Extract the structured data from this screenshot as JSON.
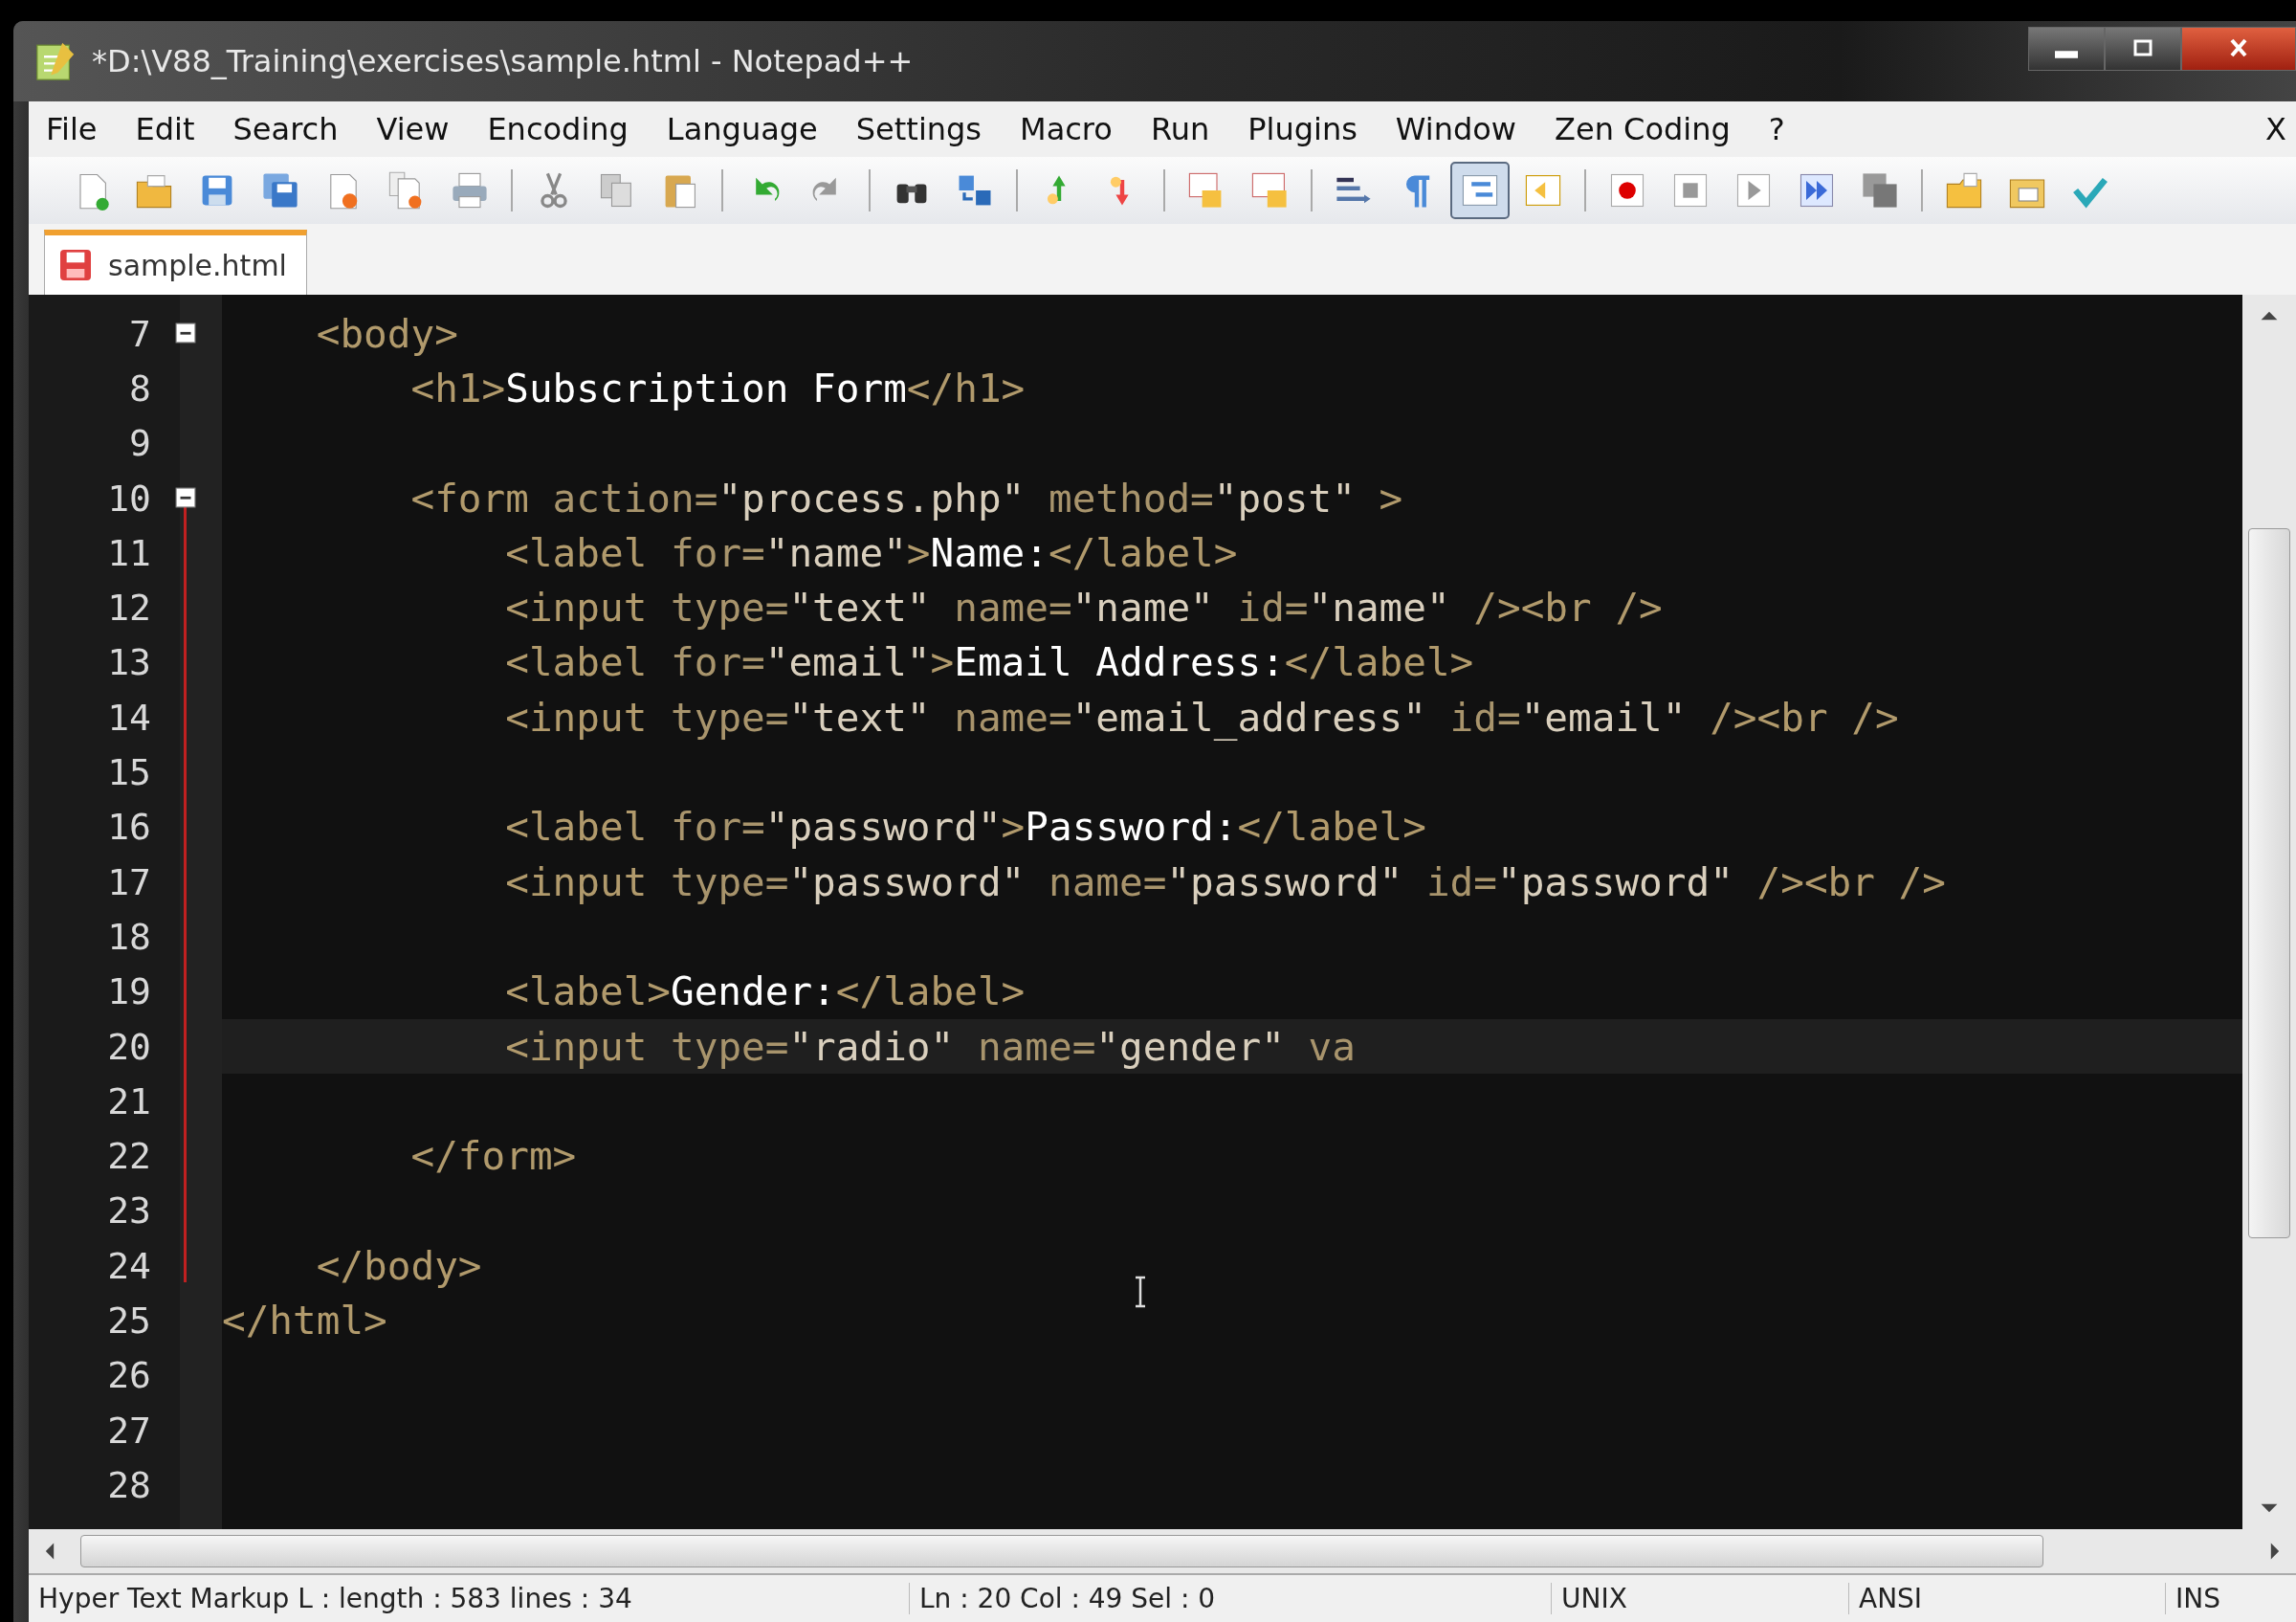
{
  "window": {
    "title": "*D:\\V88_Training\\exercises\\sample.html - Notepad++"
  },
  "menu": [
    "File",
    "Edit",
    "Search",
    "View",
    "Encoding",
    "Language",
    "Settings",
    "Macro",
    "Run",
    "Plugins",
    "Window",
    "Zen Coding",
    "?"
  ],
  "menu_close": "X",
  "toolbar": [
    {
      "kind": "button",
      "pressed": false
    },
    {
      "kind": "button",
      "pressed": false
    },
    {
      "kind": "button",
      "pressed": false
    },
    {
      "kind": "button",
      "pressed": false
    },
    {
      "kind": "button",
      "pressed": false
    },
    {
      "kind": "button",
      "pressed": false
    },
    {
      "kind": "button",
      "pressed": false
    },
    {
      "kind": "separator"
    },
    {
      "kind": "button",
      "pressed": false
    },
    {
      "kind": "button",
      "pressed": false
    },
    {
      "kind": "button",
      "pressed": false
    },
    {
      "kind": "separator"
    },
    {
      "kind": "button",
      "pressed": false
    },
    {
      "kind": "button",
      "pressed": false
    },
    {
      "kind": "separator"
    },
    {
      "kind": "button",
      "pressed": false
    },
    {
      "kind": "button",
      "pressed": false
    },
    {
      "kind": "separator"
    },
    {
      "kind": "button",
      "pressed": false
    },
    {
      "kind": "button",
      "pressed": false
    },
    {
      "kind": "separator"
    },
    {
      "kind": "button",
      "pressed": false
    },
    {
      "kind": "button",
      "pressed": false
    },
    {
      "kind": "separator"
    },
    {
      "kind": "button",
      "pressed": false
    },
    {
      "kind": "button",
      "pressed": false
    },
    {
      "kind": "button",
      "pressed": true
    },
    {
      "kind": "button",
      "pressed": false
    },
    {
      "kind": "separator"
    },
    {
      "kind": "button",
      "pressed": false
    },
    {
      "kind": "button",
      "pressed": false
    },
    {
      "kind": "button",
      "pressed": false
    },
    {
      "kind": "button",
      "pressed": false
    },
    {
      "kind": "button",
      "pressed": false
    },
    {
      "kind": "separator"
    },
    {
      "kind": "button",
      "pressed": false
    },
    {
      "kind": "button",
      "pressed": false
    },
    {
      "kind": "button",
      "pressed": false
    }
  ],
  "tabs": [
    {
      "label": "sample.html",
      "selected": true
    }
  ],
  "editor": {
    "lines": [
      {
        "number": "7",
        "current": false,
        "in_block": false,
        "fold_expanded": true,
        "tokens": [
          {
            "kind": "tag",
            "text": "    <body>"
          }
        ]
      },
      {
        "number": "8",
        "current": false,
        "in_block": false,
        "tokens": [
          {
            "kind": "tag",
            "text": "        <h1>"
          },
          {
            "kind": "text",
            "text": "Subscription Form"
          },
          {
            "kind": "tag",
            "text": "</h1>"
          }
        ]
      },
      {
        "number": "9",
        "current": false,
        "in_block": false
      },
      {
        "number": "10",
        "current": false,
        "in_block": true,
        "fold_expanded": true,
        "tokens": [
          {
            "kind": "tag",
            "text": "        <form"
          },
          {
            "kind": "attr",
            "text": " action="
          },
          {
            "kind": "string",
            "text": "\"process.php\""
          },
          {
            "kind": "attr",
            "text": " method="
          },
          {
            "kind": "string",
            "text": "\"post\""
          },
          {
            "kind": "tag",
            "text": " >"
          }
        ]
      },
      {
        "number": "11",
        "current": false,
        "in_block": true,
        "tokens": [
          {
            "kind": "tag",
            "text": "            <label"
          },
          {
            "kind": "attr",
            "text": " for="
          },
          {
            "kind": "string",
            "text": "\"name\""
          },
          {
            "kind": "tag",
            "text": ">"
          },
          {
            "kind": "text",
            "text": "Name:"
          },
          {
            "kind": "tag",
            "text": "</label>"
          }
        ]
      },
      {
        "number": "12",
        "current": false,
        "in_block": true,
        "tokens": [
          {
            "kind": "tag",
            "text": "            <input"
          },
          {
            "kind": "attr",
            "text": " type="
          },
          {
            "kind": "string",
            "text": "\"text\""
          },
          {
            "kind": "attr",
            "text": " name="
          },
          {
            "kind": "string",
            "text": "\"name\""
          },
          {
            "kind": "attr",
            "text": " id="
          },
          {
            "kind": "string",
            "text": "\"name\""
          },
          {
            "kind": "tag",
            "text": " /><br />"
          }
        ]
      },
      {
        "number": "13",
        "current": false,
        "in_block": true,
        "tokens": [
          {
            "kind": "tag",
            "text": "            <label"
          },
          {
            "kind": "attr",
            "text": " for="
          },
          {
            "kind": "string",
            "text": "\"email\""
          },
          {
            "kind": "tag",
            "text": ">"
          },
          {
            "kind": "text",
            "text": "Email Address:"
          },
          {
            "kind": "tag",
            "text": "</label>"
          }
        ]
      },
      {
        "number": "14",
        "current": false,
        "in_block": true,
        "tokens": [
          {
            "kind": "tag",
            "text": "            <input"
          },
          {
            "kind": "attr",
            "text": " type="
          },
          {
            "kind": "string",
            "text": "\"text\""
          },
          {
            "kind": "attr",
            "text": " name="
          },
          {
            "kind": "string",
            "text": "\"email_address\""
          },
          {
            "kind": "attr",
            "text": " id="
          },
          {
            "kind": "string",
            "text": "\"email\""
          },
          {
            "kind": "tag",
            "text": " /><br />"
          }
        ]
      },
      {
        "number": "15",
        "current": false,
        "in_block": true
      },
      {
        "number": "16",
        "current": false,
        "in_block": true,
        "tokens": [
          {
            "kind": "tag",
            "text": "            <label"
          },
          {
            "kind": "attr",
            "text": " for="
          },
          {
            "kind": "string",
            "text": "\"password\""
          },
          {
            "kind": "tag",
            "text": ">"
          },
          {
            "kind": "text",
            "text": "Password:"
          },
          {
            "kind": "tag",
            "text": "</label>"
          }
        ]
      },
      {
        "number": "17",
        "current": false,
        "in_block": true,
        "tokens": [
          {
            "kind": "tag",
            "text": "            <input"
          },
          {
            "kind": "attr",
            "text": " type="
          },
          {
            "kind": "string",
            "text": "\"password\""
          },
          {
            "kind": "attr",
            "text": " name="
          },
          {
            "kind": "string",
            "text": "\"password\""
          },
          {
            "kind": "attr",
            "text": " id="
          },
          {
            "kind": "string",
            "text": "\"password\""
          },
          {
            "kind": "tag",
            "text": " /><br />"
          }
        ]
      },
      {
        "number": "18",
        "current": false,
        "in_block": true
      },
      {
        "number": "19",
        "current": false,
        "in_block": true,
        "tokens": [
          {
            "kind": "tag",
            "text": "            <label>"
          },
          {
            "kind": "text",
            "text": "Gender:"
          },
          {
            "kind": "tag",
            "text": "</label>"
          }
        ]
      },
      {
        "number": "20",
        "current": true,
        "in_block": true,
        "tokens": [
          {
            "kind": "tag",
            "text": "            <input"
          },
          {
            "kind": "attr",
            "text": " type="
          },
          {
            "kind": "string",
            "text": "\"radio\""
          },
          {
            "kind": "attr",
            "text": " name="
          },
          {
            "kind": "string",
            "text": "\"gender\""
          },
          {
            "kind": "attr",
            "text": " va"
          }
        ]
      },
      {
        "number": "21",
        "current": false,
        "in_block": true
      },
      {
        "number": "22",
        "current": false,
        "in_block": true,
        "tokens": [
          {
            "kind": "tag",
            "text": "        </form>"
          }
        ]
      },
      {
        "number": "23",
        "current": false,
        "in_block": true
      },
      {
        "number": "24",
        "current": false,
        "in_block": true,
        "tokens": [
          {
            "kind": "tag",
            "text": "    </body>"
          }
        ]
      },
      {
        "number": "25",
        "current": false,
        "in_block": false,
        "tokens": [
          {
            "kind": "tag",
            "text": "</html>"
          }
        ]
      },
      {
        "number": "26",
        "current": false,
        "in_block": false
      },
      {
        "number": "27",
        "current": false,
        "in_block": false
      },
      {
        "number": "28",
        "current": false,
        "in_block": false
      }
    ]
  },
  "status_bar": [
    "Hyper Text Markup L : length : 583    lines : 34",
    "Ln : 20    Col : 49    Sel : 0",
    "UNIX",
    "ANSI",
    "INS"
  ]
}
